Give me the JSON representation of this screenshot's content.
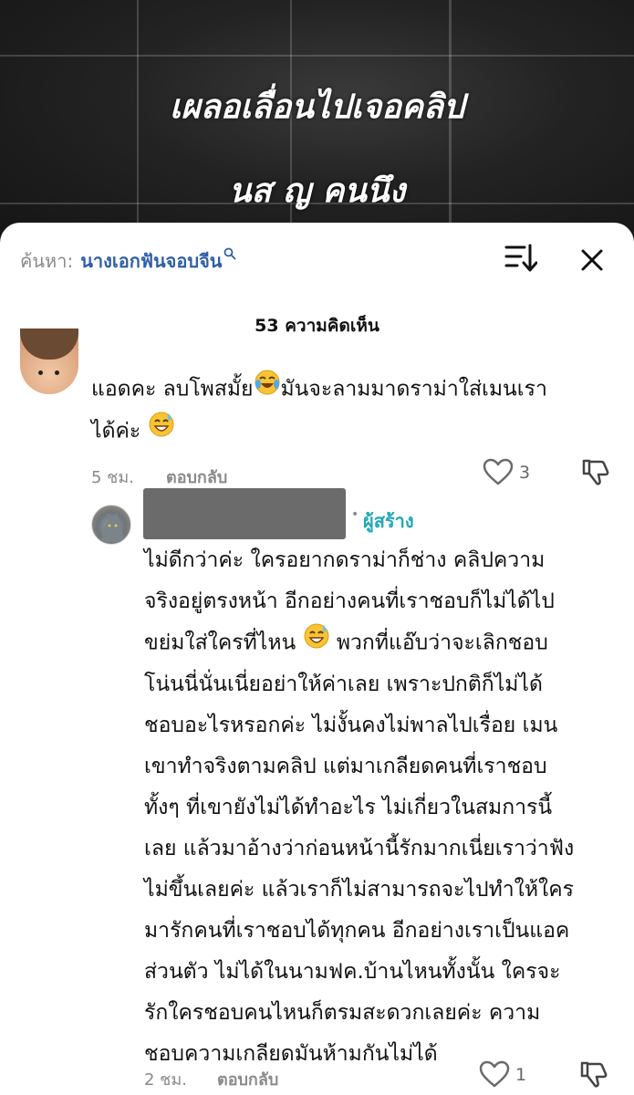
{
  "video": {
    "overlay_line1": "เผลอเลื่อนไปเจอคลิป",
    "overlay_line2": "นส ญ คนนึง"
  },
  "header": {
    "search_prefix": "ค้นหา:",
    "search_term": "นางเอกฟันจอบจีน",
    "comment_count": "53 ความคิดเห็น"
  },
  "comments": [
    {
      "text_part1": "แอดคะ ลบโพสมั้ย",
      "text_part2": "มันจะลามมาดราม่าใส่เมนเรา",
      "text_part3": "ได้ค่ะ",
      "time": "5 ชม.",
      "reply_label": "ตอบกลับ",
      "likes": "3"
    },
    {
      "creator_label": "ผู้สร้าง",
      "line1": "ไม่ดีกว่าค่ะ ใครอยากดราม่าก็ช่าง คลิปความ",
      "line2": "จริงอยู่ตรงหน้า อีกอย่างคนที่เราชอบก็ไม่ได้ไป",
      "line3a": "ขย่มใส่ใครที่ไหน",
      "line3b": "พวกที่แอ๊บว่าจะเลิกชอบ",
      "line4": "โน่นนี่นั่นเนี่ยอย่าให้ค่าเลย เพราะปกติก็ไม่ได้",
      "line5": "ชอบอะไรหรอกค่ะ ไม่งั้นคงไม่พาลไปเรื่อย เมน",
      "line6": "เขาทำจริงตามคลิป แต่มาเกลียดคนที่เราชอบ",
      "line7": "ทั้งๆ ที่เขายังไม่ได้ทำอะไร ไม่เกี่ยวในสมการนี้",
      "line8": "เลย แล้วมาอ้างว่าก่อนหน้านี้รักมากเนี่ยเราว่าฟัง",
      "line9": "ไม่ขึ้นเลยค่ะ แล้วเราก็ไม่สามารถจะไปทำให้ใคร",
      "line10": "มารักคนที่เราชอบได้ทุกคน อีกอย่างเราเป็นแอค",
      "line11": "ส่วนตัว ไม่ได้ในนามฟค.บ้านไหนทั้งนั้น ใครจะ",
      "line12": "รักใครชอบคนไหนก็ตรมสะดวกเลยค่ะ ความ",
      "line13": "ชอบความเกลียดมันห้ามกันไม่ได้",
      "time": "2 ชม.",
      "reply_label": "ตอบกลับ",
      "likes": "1"
    }
  ],
  "icons": {
    "search": "search-icon",
    "sort": "sort-icon",
    "close": "close-icon",
    "heart": "heart-icon",
    "dislike": "dislike-icon",
    "laugh_emoji": "tears-of-joy-emoji",
    "sweat_emoji": "grinning-sweat-emoji"
  },
  "colors": {
    "search_term": "#2f5fa8",
    "creator_badge": "#1fa8b8"
  }
}
